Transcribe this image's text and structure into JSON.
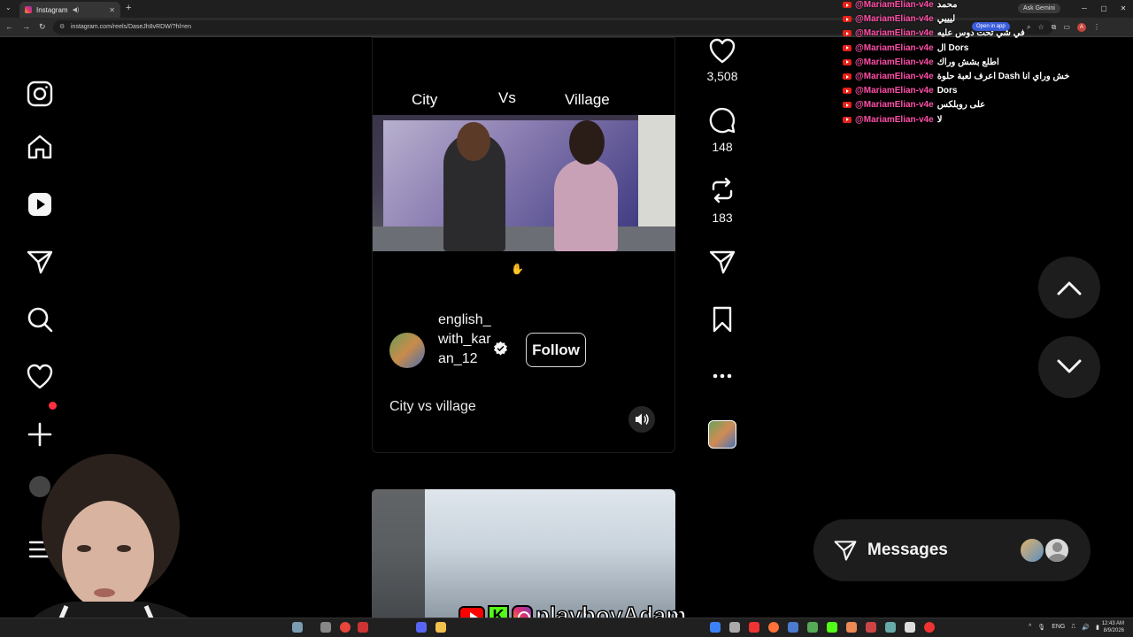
{
  "browser": {
    "tab_title": "Instagram",
    "url": "instagram.com/reels/DaseJh8vRDW/?hl=en",
    "open_in_app": "Open in app",
    "ask_gemini": "Ask Gemini",
    "new_tab": "+",
    "close_tab": "✕"
  },
  "sidebar": {
    "items": [
      "instagram-logo",
      "home",
      "reels",
      "direct",
      "search",
      "notifications",
      "create",
      "more"
    ]
  },
  "reel": {
    "video_title_left": "City",
    "video_title_mid": "Vs",
    "video_title_right": "Village",
    "username": "english_with_karan_12",
    "follow_label": "Follow",
    "caption": "City vs village"
  },
  "actions": {
    "likes": "3,508",
    "comments": "148",
    "reposts": "183"
  },
  "messages": {
    "label": "Messages"
  },
  "chat": [
    {
      "user": "@MariamElian-v4e",
      "msg": "محمد"
    },
    {
      "user": "@MariamElian-v4e",
      "msg": "ليييي"
    },
    {
      "user": "@MariamElian-v4e",
      "msg": "في شي تحت دوس عليه"
    },
    {
      "user": "@MariamElian-v4e",
      "msg": "ال Dors"
    },
    {
      "user": "@MariamElian-v4e",
      "msg": "اطلع بشش وراك"
    },
    {
      "user": "@MariamElian-v4e",
      "msg": "اعرف لعبة حلوة Dash خش وراي انا"
    },
    {
      "user": "@MariamElian-v4e",
      "msg": "Dors"
    },
    {
      "user": "@MariamElian-v4e",
      "msg": "على روبلكس"
    },
    {
      "user": "@MariamElian-v4e",
      "msg": "لا"
    }
  ],
  "stream": {
    "handle": "playboyAdam",
    "kick_letter": "K"
  },
  "taskbar": {
    "lang": "ENG",
    "time": "12:43 AM",
    "date": "8/9/2026"
  },
  "colors": {
    "accent_red": "#ff3040",
    "chat_user": "#ff4fa8",
    "background": "#000000"
  }
}
